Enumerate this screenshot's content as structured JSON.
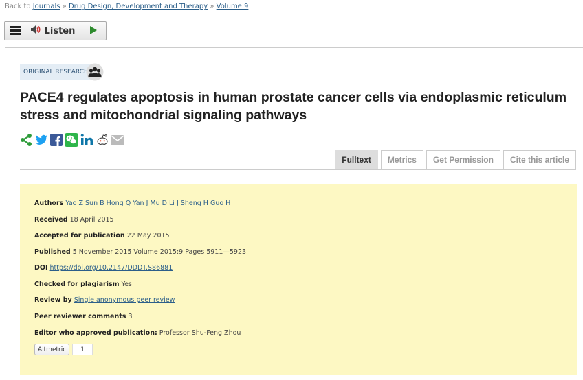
{
  "breadcrumb": {
    "prefix": "Back to",
    "items": [
      "Journals",
      "Drug Design, Development and Therapy",
      "Volume 9"
    ],
    "separator": "»"
  },
  "listen": {
    "label": "Listen"
  },
  "article": {
    "badge": "ORIGINAL RESEARCH",
    "title": "PACE4 regulates apoptosis in human prostate cancer cells via endoplasmic reticulum stress and mitochondrial signaling pathways"
  },
  "social_icons": [
    "share-icon",
    "twitter-icon",
    "facebook-icon",
    "wechat-icon",
    "linkedin-icon",
    "reddit-icon",
    "email-icon"
  ],
  "tabs": [
    {
      "label": "Fulltext",
      "active": true
    },
    {
      "label": "Metrics",
      "active": false
    },
    {
      "label": "Get Permission",
      "active": false
    },
    {
      "label": "Cite this article",
      "active": false
    }
  ],
  "meta": {
    "authors_label": "Authors",
    "authors": [
      "Yao Z",
      "Sun B",
      "Hong Q",
      "Yan J",
      "Mu D",
      "Li J",
      "Sheng H",
      "Guo H"
    ],
    "received_label": "Received",
    "received": "18 April 2015",
    "accepted_label": "Accepted for publication",
    "accepted": "22 May 2015",
    "published_label": "Published",
    "published": "5 November 2015 Volume 2015:9 Pages 5911—5923",
    "doi_label": "DOI",
    "doi": "https://doi.org/10.2147/DDDT.S86881",
    "plagiarism_label": "Checked for plagiarism",
    "plagiarism": "Yes",
    "review_label": "Review by",
    "review": "Single anonymous peer review",
    "comments_label": "Peer reviewer comments",
    "comments": "3",
    "editor_label": "Editor who approved publication:",
    "editor": "Professor Shu-Feng Zhou",
    "altmetric_label": "Altmetric",
    "altmetric_count": "1"
  },
  "colors": {
    "meta_bg": "#fdf8c3",
    "link": "#2c5f8a",
    "share_green": "#2e9c3a",
    "badge_bg": "#e4edf5"
  }
}
